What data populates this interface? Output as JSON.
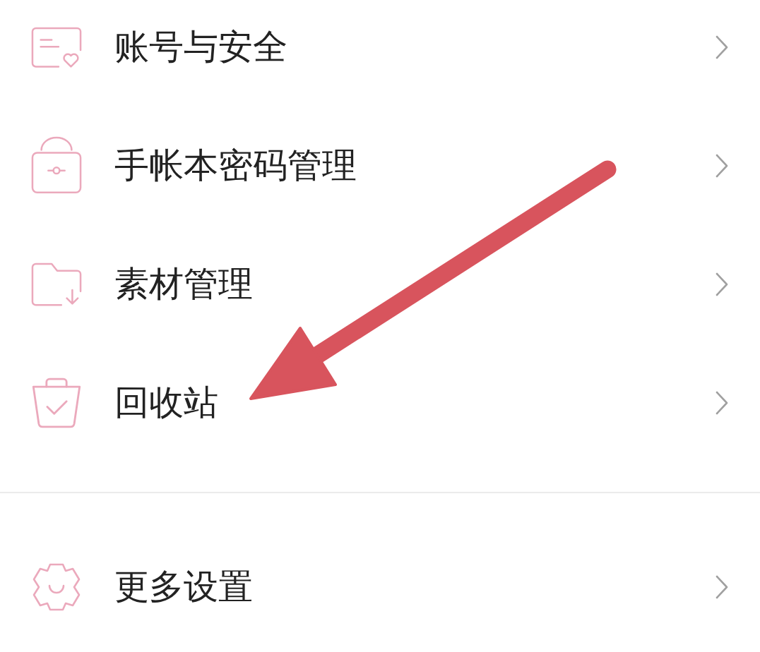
{
  "settings_list": {
    "groups": [
      {
        "items": [
          {
            "label": "账号与安全"
          },
          {
            "label": "手帐本密码管理"
          },
          {
            "label": "素材管理"
          },
          {
            "label": "回收站"
          }
        ]
      },
      {
        "items": [
          {
            "label": "更多设置"
          }
        ]
      }
    ]
  },
  "annotations": [
    {
      "kind": "arrow"
    }
  ]
}
